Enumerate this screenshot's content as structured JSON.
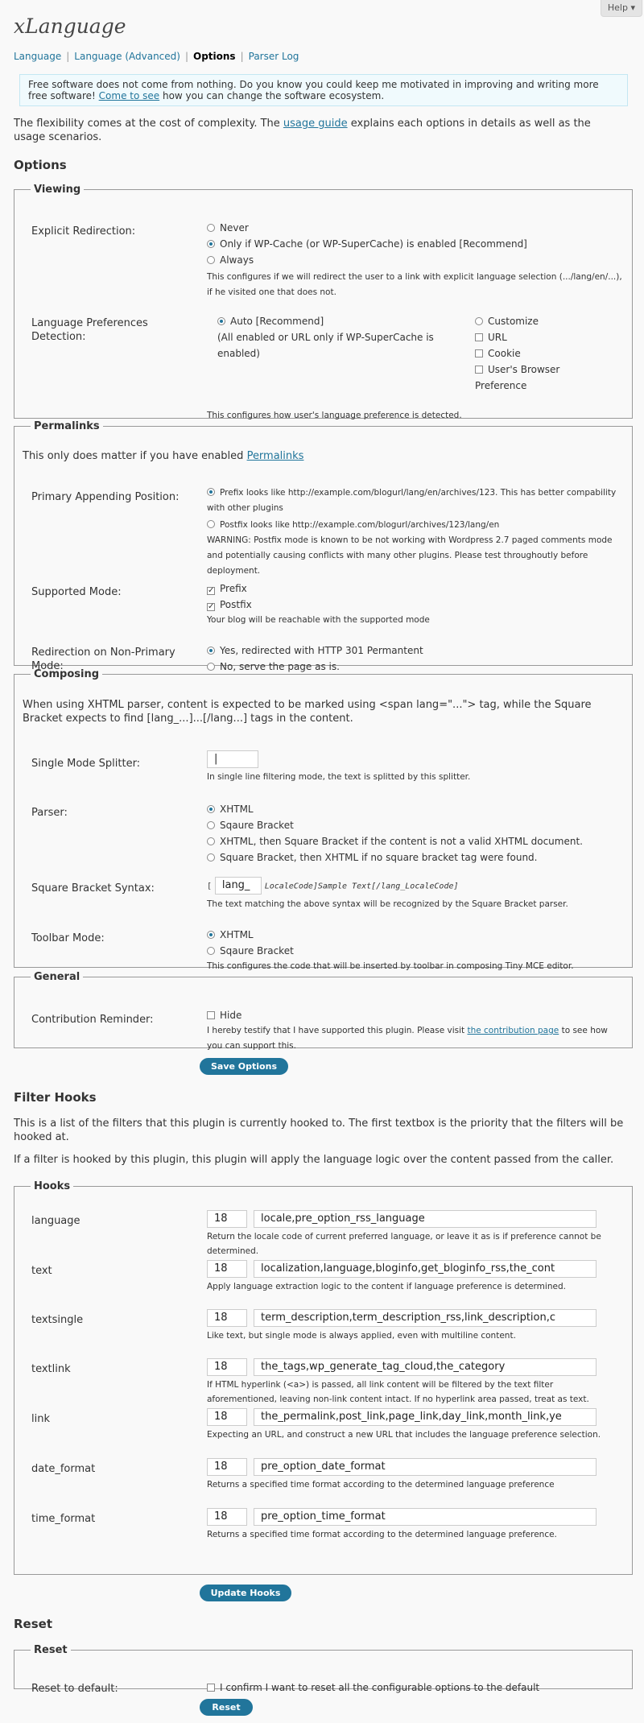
{
  "app": {
    "title": "xLanguage",
    "help": "Help"
  },
  "nav": {
    "language": "Language",
    "language_adv": "Language (Advanced)",
    "options": "Options",
    "parser_log": "Parser Log",
    "sep": "|"
  },
  "notice": {
    "text": "Free software does not come from nothing. Do you know you could keep me motivated in improving and writing more free software!",
    "link": "Come to see",
    "text2": " how you can change the software ecosystem."
  },
  "intro": {
    "pre": "The flexibility comes at the cost of complexity. The ",
    "link": "usage guide",
    "post": " explains each options in details as well as the usage scenarios."
  },
  "options_heading": "Options",
  "viewing": {
    "legend": "Viewing",
    "redirect_label": "Explicit Redirection:",
    "redirect_opts": [
      "Never",
      "Only if WP-Cache (or WP-SuperCache) is enabled [Recommend]",
      "Always"
    ],
    "redirect_desc": "This configures if we will redirect the user to a link with explicit language selection (.../lang/en/...), if he visited one that does not.",
    "pref_label": "Language Preferences Detection:",
    "pref_auto": "Auto [Recommend]",
    "pref_auto_desc": "(All enabled or URL only if WP-SuperCache is enabled)",
    "pref_custom": "Customize",
    "pref_url": "URL",
    "pref_cookie": "Cookie",
    "pref_browser": "User's Browser Preference",
    "pref_desc": "This configures how user's language preference is detected."
  },
  "permalinks": {
    "legend": "Permalinks",
    "note_pre": "This only does matter if you have enabled ",
    "note_link": "Permalinks",
    "primary_label": "Primary Appending Position:",
    "prefix_opt": "Prefix looks like http://example.com/blogurl/lang/en/archives/123. This has better compability with other plugins",
    "postfix_opt": "Postfix looks like http://example.com/blogurl/archives/123/lang/en",
    "warning": "WARNING: Postfix mode is known to be not working with Wordpress 2.7 paged comments mode and potentially causing conflicts with many other plugins. Please test throughoutly before deployment.",
    "supported_label": "Supported Mode:",
    "sup_prefix": "Prefix",
    "sup_postfix": "Postfix",
    "sup_desc": "Your blog will be reachable with the supported mode",
    "redir_label": "Redirection on Non-Primary Mode:",
    "redir_yes": "Yes, redirected with HTTP 301 Permantent",
    "redir_no": "No, serve the page as is."
  },
  "composing": {
    "legend": "Composing",
    "note": "When using XHTML parser, content is expected to be marked using <span lang=\"...\"> tag, while the Square Bracket expects to find [lang_...]...[/lang...] tags in the content.",
    "splitter_label": "Single Mode Splitter:",
    "splitter_value": "|",
    "splitter_desc": "In single line filtering mode, the text is splitted by this splitter.",
    "parser_label": "Parser:",
    "parser_opts": [
      "XHTML",
      "Sqaure Bracket",
      "XHTML, then Square Bracket if the content is not a valid XHTML document.",
      "Square Bracket, then XHTML if no square bracket tag were found."
    ],
    "syntax_label": "Square Bracket Syntax:",
    "syntax_open": "[",
    "syntax_value": "lang_",
    "syntax_rest": "LocaleCode]Sample Text[/lang_LocaleCode]",
    "syntax_desc": "The text matching the above syntax will be recognized by the Square Bracket parser.",
    "toolbar_label": "Toolbar Mode:",
    "toolbar_opts": [
      "XHTML",
      "Sqaure Bracket"
    ],
    "toolbar_desc": "This configures the code that will be inserted by toolbar in composing Tiny MCE editor."
  },
  "general": {
    "legend": "General",
    "reminder_label": "Contribution Reminder:",
    "hide": "Hide",
    "desc_pre": "I hereby testify that I have supported this plugin. Please visit ",
    "desc_link": "the contribution page",
    "desc_post": " to see how you can support this."
  },
  "save_options": "Save Options",
  "filter_heading": "Filter Hooks",
  "filter_p1": "This is a list of the filters that this plugin is currently hooked to. The first textbox is the priority that the filters will be hooked at.",
  "filter_p2": "If a filter is hooked by this plugin, this plugin will apply the language logic over the content passed from the caller.",
  "hooks": {
    "legend": "Hooks",
    "items": [
      {
        "name": "language",
        "priority": "18",
        "filters": "locale,pre_option_rss_language",
        "desc": "Return the locale code of current preferred language, or leave it as is if preference cannot be determined."
      },
      {
        "name": "text",
        "priority": "18",
        "filters": "localization,language,bloginfo,get_bloginfo_rss,the_cont",
        "desc": "Apply language extraction logic to the content if language preference is determined."
      },
      {
        "name": "textsingle",
        "priority": "18",
        "filters": "term_description,term_description_rss,link_description,c",
        "desc": "Like text, but single mode is always applied, even with multiline content."
      },
      {
        "name": "textlink",
        "priority": "18",
        "filters": "the_tags,wp_generate_tag_cloud,the_category",
        "desc": "If HTML hyperlink (<a>) is passed, all link content will be filtered by the text filter aforementioned, leaving non-link content intact. If no hyperlink area passed, treat as text."
      },
      {
        "name": "link",
        "priority": "18",
        "filters": "the_permalink,post_link,page_link,day_link,month_link,ye",
        "desc": "Expecting an URL, and construct a new URL that includes the language preference selection."
      },
      {
        "name": "date_format",
        "priority": "18",
        "filters": "pre_option_date_format",
        "desc": "Returns a specified time format according to the determined language preference"
      },
      {
        "name": "time_format",
        "priority": "18",
        "filters": "pre_option_time_format",
        "desc": "Returns a specified time format according to the determined language preference."
      }
    ]
  },
  "update_hooks": "Update Hooks",
  "reset_heading": "Reset",
  "reset": {
    "legend": "Reset",
    "label": "Reset to default:",
    "confirm": "I confirm I want to reset all the configurable options to the default",
    "button": "Reset"
  }
}
